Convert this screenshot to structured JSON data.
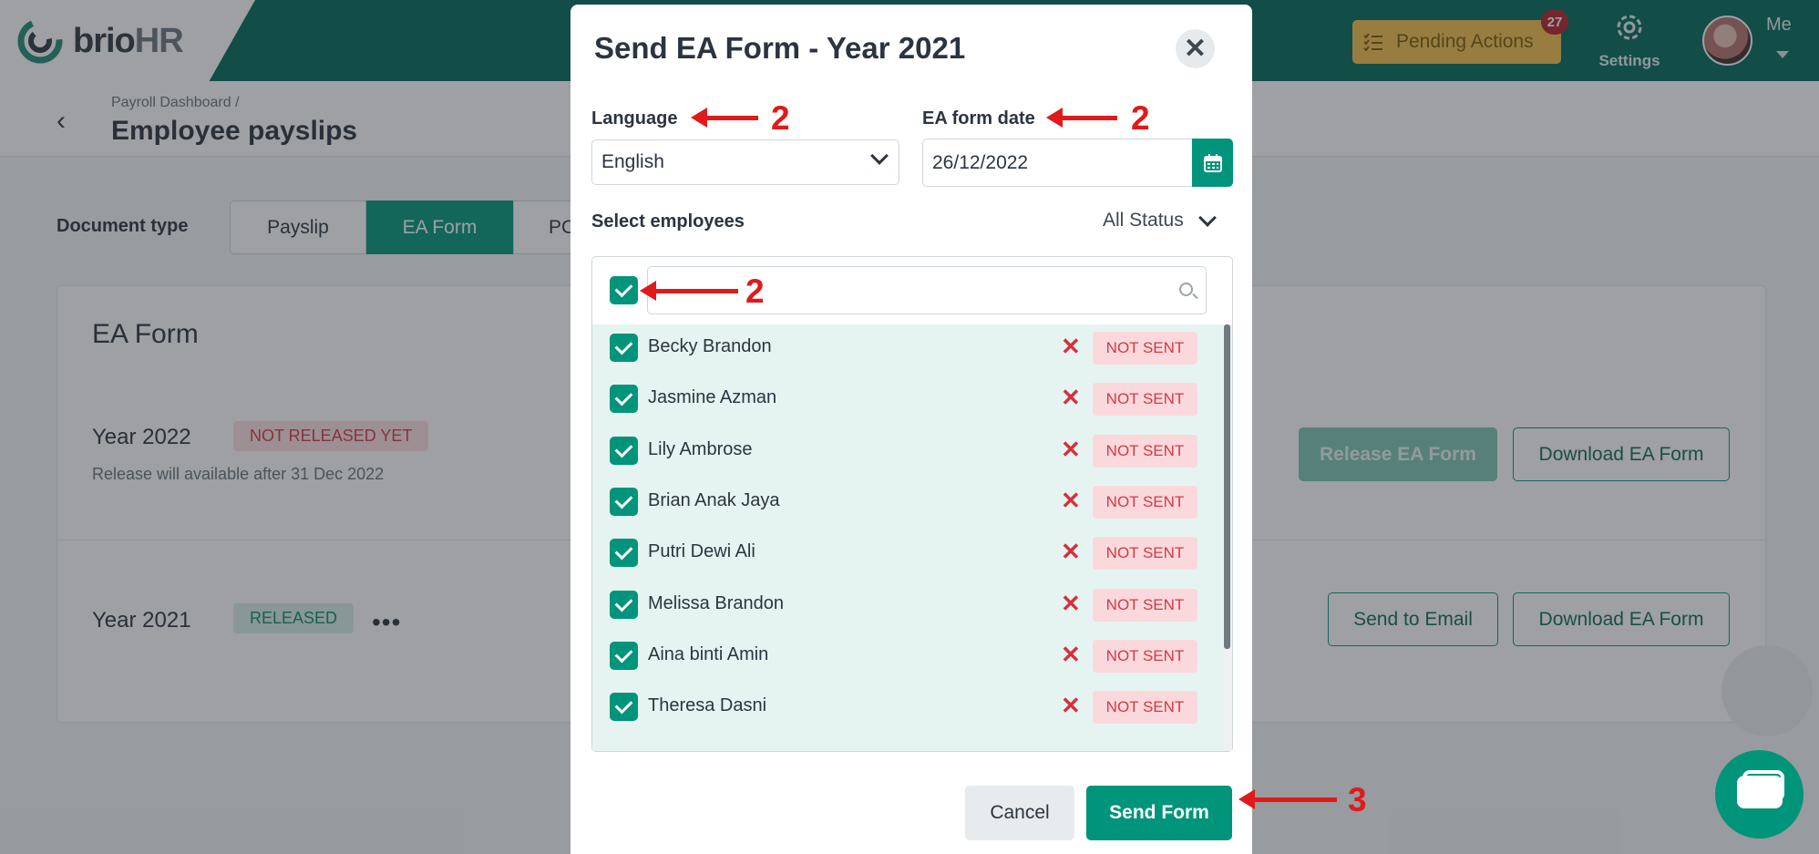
{
  "app": {
    "logo_brio": "brio",
    "logo_hr": "HR",
    "pending_label": "Pending Actions",
    "pending_count": "27",
    "settings_label": "Settings",
    "user_label": "Me"
  },
  "header": {
    "breadcrumb": "Payroll Dashboard  /",
    "title": "Employee payslips"
  },
  "page": {
    "doc_type_label": "Document type",
    "tabs": [
      {
        "label": "Payslip",
        "active": false
      },
      {
        "label": "EA Form",
        "active": true
      },
      {
        "label": "PC",
        "active": false
      }
    ],
    "card_title": "EA Form",
    "years": [
      {
        "label": "Year 2022",
        "status": "NOT RELEASED YET",
        "note": "Release will available after 31 Dec 2022",
        "primary_action": "Release EA Form",
        "secondary_action": "Download EA Form"
      },
      {
        "label": "Year 2021",
        "status": "RELEASED",
        "more": "•••",
        "primary_action": "Send to Email",
        "secondary_action": "Download EA Form"
      }
    ]
  },
  "modal": {
    "title": "Send EA Form - Year 2021",
    "close_glyph": "✕",
    "language_label": "Language",
    "language_value": "English",
    "date_label": "EA form date",
    "date_value": "26/12/2022",
    "select_label": "Select employees",
    "status_filter": "All Status",
    "search_placeholder": "",
    "employees": [
      {
        "name": "Becky Brandon",
        "status": "NOT SENT",
        "checked": true
      },
      {
        "name": "Jasmine Azman",
        "status": "NOT SENT",
        "checked": true
      },
      {
        "name": "Lily Ambrose",
        "status": "NOT SENT",
        "checked": true
      },
      {
        "name": "Brian Anak Jaya",
        "status": "NOT SENT",
        "checked": true
      },
      {
        "name": "Putri Dewi Ali",
        "status": "NOT SENT",
        "checked": true
      },
      {
        "name": "Melissa Brandon",
        "status": "NOT SENT",
        "checked": true
      },
      {
        "name": "Aina binti Amin",
        "status": "NOT SENT",
        "checked": true
      },
      {
        "name": "Theresa Dasni",
        "status": "NOT SENT",
        "checked": true
      }
    ],
    "cancel_label": "Cancel",
    "send_label": "Send Form"
  },
  "annotations": {
    "step_language": "2",
    "step_date": "2",
    "step_select_all": "2",
    "step_send": "3"
  },
  "colors": {
    "brand_dark": "#00685a",
    "brand": "#00957a",
    "pending": "#f2c14b",
    "annotation": "#e01a1a"
  },
  "icons": [
    "logo-icon",
    "checklist-icon",
    "gear-icon",
    "back-arrow-icon",
    "calendar-icon",
    "search-icon",
    "close-icon",
    "chevron-down-icon",
    "chat-icon"
  ]
}
